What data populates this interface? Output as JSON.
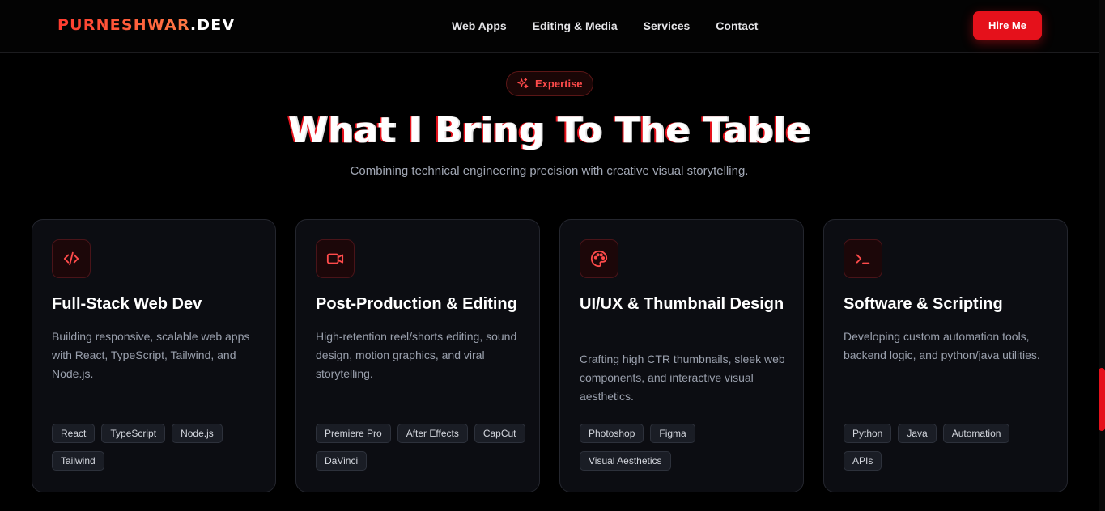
{
  "header": {
    "logo_brand": "PURNESHWAR",
    "logo_tld": ".DEV",
    "nav": [
      "Web Apps",
      "Editing & Media",
      "Services",
      "Contact"
    ],
    "hire_label": "Hire Me"
  },
  "hero": {
    "badge": "Expertise",
    "title": "What I Bring To The Table",
    "subtitle": "Combining technical engineering precision with creative visual storytelling."
  },
  "cards": [
    {
      "icon": "code-icon",
      "title": "Full-Stack Web Dev",
      "description": "Building responsive, scalable web apps with React, TypeScript, Tailwind, and Node.js.",
      "tags": [
        "React",
        "TypeScript",
        "Node.js",
        "Tailwind"
      ]
    },
    {
      "icon": "video-camera-icon",
      "title": "Post-Production & Editing",
      "description": "High-retention reel/shorts editing, sound design, motion graphics, and viral storytelling.",
      "tags": [
        "Premiere Pro",
        "After Effects",
        "CapCut",
        "DaVinci"
      ]
    },
    {
      "icon": "palette-icon",
      "title": "UI/UX & Thumbnail Design",
      "description": "Crafting high CTR thumbnails, sleek web components, and interactive visual aesthetics.",
      "tags": [
        "Photoshop",
        "Figma",
        "Visual Aesthetics"
      ]
    },
    {
      "icon": "terminal-icon",
      "title": "Software & Scripting",
      "description": "Developing custom automation tools, backend logic, and python/java utilities.",
      "tags": [
        "Python",
        "Java",
        "Automation",
        "APIs"
      ]
    }
  ],
  "colors": {
    "accent": "#e5111b",
    "background": "#000000",
    "card_bg": "#0c0d12"
  }
}
